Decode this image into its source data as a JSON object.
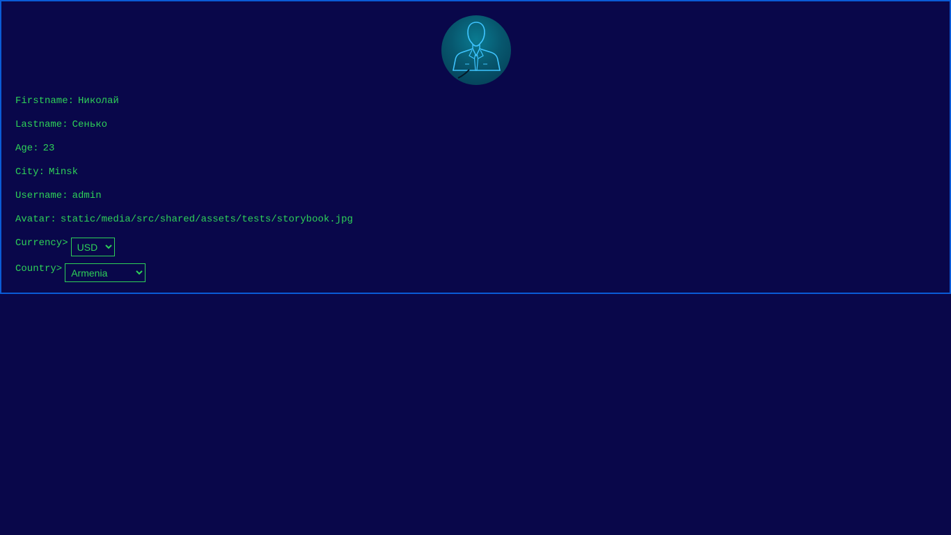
{
  "profile": {
    "avatar_alt": "user-avatar",
    "fields": {
      "firstname": {
        "label": "Firstname:",
        "value": "Николай"
      },
      "lastname": {
        "label": "Lastname:",
        "value": "Сенько"
      },
      "age": {
        "label": "Age:",
        "value": "23"
      },
      "city": {
        "label": "City:",
        "value": "Minsk"
      },
      "username": {
        "label": "Username:",
        "value": "admin"
      },
      "avatar": {
        "label": "Avatar:",
        "value": "static/media/src/shared/assets/tests/storybook.jpg"
      }
    },
    "currency": {
      "label": "Currency>",
      "selected": "USD"
    },
    "country": {
      "label": "Country>",
      "selected": "Armenia"
    }
  },
  "colors": {
    "background": "#09074a",
    "border": "#0a5bd6",
    "text": "#2ed158",
    "avatar_outline": "#3fc4ff"
  }
}
